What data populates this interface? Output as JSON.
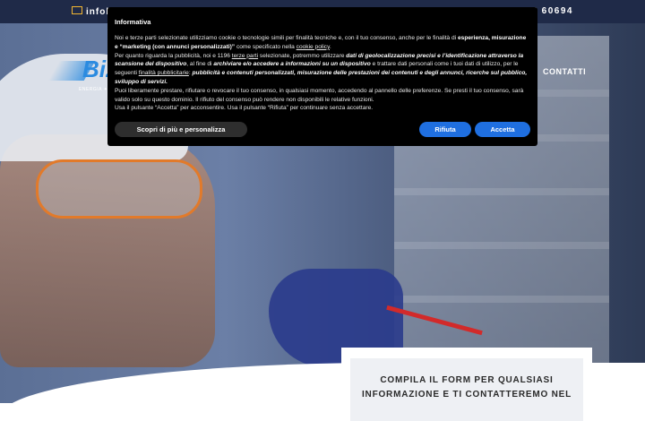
{
  "topbar": {
    "email": "infob",
    "phone": "5 60694"
  },
  "header": {
    "logo_text": "Biz",
    "logo_subtitle": "ENERGIA ✦ SIC",
    "nav_contatti": "CONTATTI"
  },
  "cookie": {
    "title": "Informativa",
    "p1_a": "Noi e terze parti selezionate utilizziamo cookie o tecnologie simili per finalità tecniche e, con il tuo consenso, anche per le finalità di ",
    "p1_b": "esperienza, misurazione e “marketing (con annunci personalizzati)”",
    "p1_c": " come specificato nella ",
    "p1_link": "cookie policy",
    "p1_d": ".",
    "p2_a": "Per quanto riguarda la pubblicità, noi e 1196 ",
    "p2_link": "terze parti",
    "p2_b": " selezionate, potremmo utilizzare ",
    "p2_c": "dati di geolocalizzazione precisi e l’identificazione attraverso la scansione del dispositivo",
    "p2_d": ", al fine di ",
    "p2_e": "archiviare e/o accedere a informazioni su un dispositivo",
    "p2_f": " e trattare dati personali come i tuoi dati di utilizzo, per le seguenti ",
    "p2_link2": "finalità pubblicitarie",
    "p2_g": ": ",
    "p2_h": "pubblicità e contenuti personalizzati, misurazione delle prestazioni dei contenuti e degli annunci, ricerche sul pubblico, sviluppo di servizi.",
    "p3": "Puoi liberamente prestare, rifiutare o revocare il tuo consenso, in qualsiasi momento, accedendo al pannello delle preferenze. Se presti il tuo consenso, sarà valido solo su questo dominio. Il rifiuto del consenso può rendere non disponibili le relative funzioni.",
    "p4": "Usa il pulsante “Accetta” per acconsentire. Usa il pulsante “Rifiuta” per continuare senza accettare.",
    "btn_more": "Scopri di più e personalizza",
    "btn_reject": "Rifiuta",
    "btn_accept": "Accetta"
  },
  "form": {
    "title_line1": "COMPILA IL FORM PER QUALSIASI",
    "title_line2": "INFORMAZIONE E TI CONTATTEREMO NEL"
  }
}
